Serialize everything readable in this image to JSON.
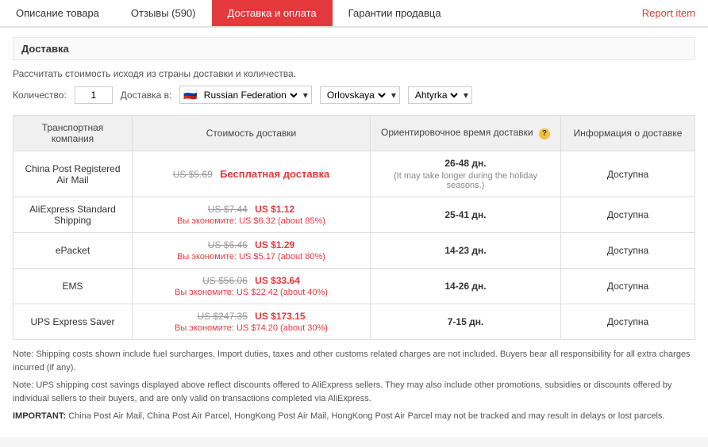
{
  "nav": {
    "tabs": [
      {
        "id": "description",
        "label": "Описание товара",
        "active": false
      },
      {
        "id": "reviews",
        "label": "Отзывы (590)",
        "active": false
      },
      {
        "id": "shipping",
        "label": "Доставка и оплата",
        "active": true
      },
      {
        "id": "guarantee",
        "label": "Гарантии продавца",
        "active": false
      }
    ],
    "report_item": "Report item"
  },
  "section": {
    "title": "Доставка",
    "calc_note": "Рассчитать стоимость исходя из страны доставки и количества.",
    "quantity_label": "Количество:",
    "quantity_value": "1",
    "delivery_label": "Доставка в:",
    "country": "Russian Federation",
    "region": "Orlovskaya",
    "city": "Ahtyrka"
  },
  "table": {
    "headers": [
      "Транспортная компания",
      "Стоимость доставки",
      "Ориентировочное время доставки",
      "Информация о доставке"
    ],
    "rows": [
      {
        "company": "China Post Registered Air Mail",
        "price_original": "US $5.69",
        "price_free": "Бесплатная доставка",
        "save": "",
        "time_main": "26-48 дн.",
        "time_note": "(It may take longer during the holiday seasons.)",
        "info": "Доступна"
      },
      {
        "company": "AliExpress Standard Shipping",
        "price_original": "US $7.44",
        "price_discounted": "US $1.12",
        "save": "Вы экономите: US $6.32 (about 85%)",
        "time_main": "25-41 дн.",
        "time_note": "",
        "info": "Доступна"
      },
      {
        "company": "ePacket",
        "price_original": "US $6.46",
        "price_discounted": "US $1.29",
        "save": "Вы экономите: US $5.17 (about 80%)",
        "time_main": "14-23 дн.",
        "time_note": "",
        "info": "Доступна"
      },
      {
        "company": "EMS",
        "price_original": "US $56.06",
        "price_discounted": "US $33.64",
        "save": "Вы экономите: US $22.42 (about 40%)",
        "time_main": "14-26 дн.",
        "time_note": "",
        "info": "Доступна"
      },
      {
        "company": "UPS Express Saver",
        "price_original": "US $247.35",
        "price_discounted": "US $173.15",
        "save": "Вы экономите: US $74.20 (about 30%)",
        "time_main": "7-15 дн.",
        "time_note": "",
        "info": "Доступна"
      }
    ]
  },
  "notes": {
    "note1": "Note: Shipping costs shown include fuel surcharges. Import duties, taxes and other customs related charges are not included. Buyers bear all responsibility for all extra charges incurred (if any).",
    "note2": "Note: UPS shipping cost savings displayed above reflect discounts offered to AliExpress sellers. They may also include other promotions, subsidies or discounts offered by individual sellers to their buyers, and are only valid on transactions completed via AliExpress.",
    "important_label": "IMPORTANT:",
    "important_text": " China Post Air Mail, China Post Air Parcel, HongKong Post Air Mail, HongKong Post Air Parcel may not be tracked and may result in delays or lost parcels."
  }
}
